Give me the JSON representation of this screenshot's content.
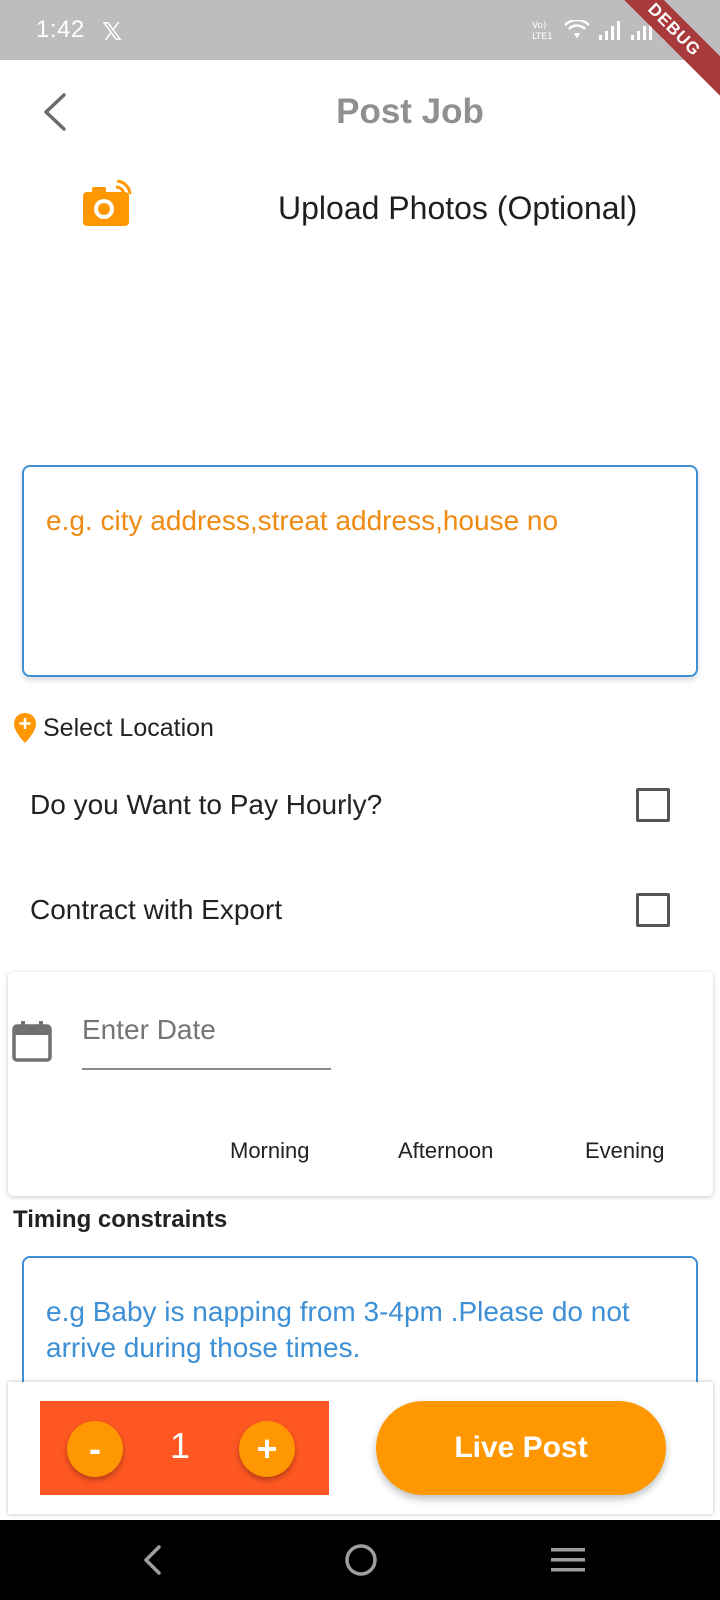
{
  "status_bar": {
    "time": "1:42",
    "notification_icon": "x-logo",
    "debug_banner": "DEBUG"
  },
  "header": {
    "title": "Post Job",
    "back_icon": "chevron-left-icon"
  },
  "upload": {
    "label": "Upload Photos (Optional)",
    "icon": "camera-icon"
  },
  "address": {
    "placeholder": "e.g. city address,streat address,house no"
  },
  "location": {
    "label": "Select Location",
    "icon": "map-pin-add-icon"
  },
  "options": {
    "pay_hourly": {
      "label": "Do you Want to Pay Hourly?",
      "checked": false
    },
    "contract_export": {
      "label": "Contract with Export",
      "checked": false
    }
  },
  "date": {
    "placeholder": "Enter Date",
    "icon": "calendar-icon",
    "times": [
      "Morning",
      "Afternoon",
      "Evening"
    ]
  },
  "timing": {
    "label": "Timing constraints",
    "placeholder": "e.g Baby is napping from 3-4pm .Please do not arrive during those times."
  },
  "stepper": {
    "minus": "-",
    "value": "1",
    "plus": "+"
  },
  "actions": {
    "live_post": "Live Post"
  },
  "colors": {
    "accent_orange": "#ff9800",
    "stepper_bg": "#ff5722",
    "input_border": "#3d8fd6",
    "address_placeholder": "#ef8a12"
  }
}
